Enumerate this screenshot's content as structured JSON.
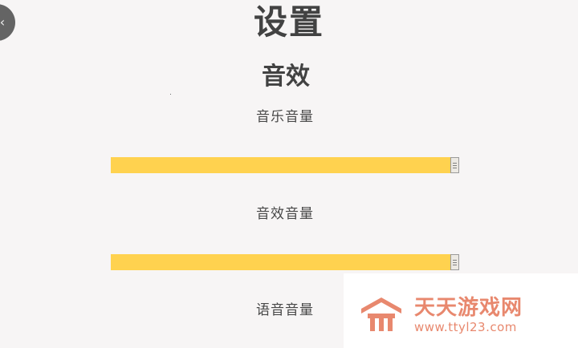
{
  "header": {
    "title": "设置",
    "back_icon": "back-arrow-icon"
  },
  "section": {
    "title": "音效"
  },
  "settings": [
    {
      "label": "音乐音量",
      "value": 1.0
    },
    {
      "label": "音效音量",
      "value": 1.0
    },
    {
      "label": "语音音量"
    }
  ],
  "colors": {
    "background": "#f7f5f5",
    "slider_fill": "#ffd24f",
    "watermark": "#e8886e"
  },
  "watermark": {
    "name": "天天游戏网",
    "url": "www.ttyl23.com"
  }
}
